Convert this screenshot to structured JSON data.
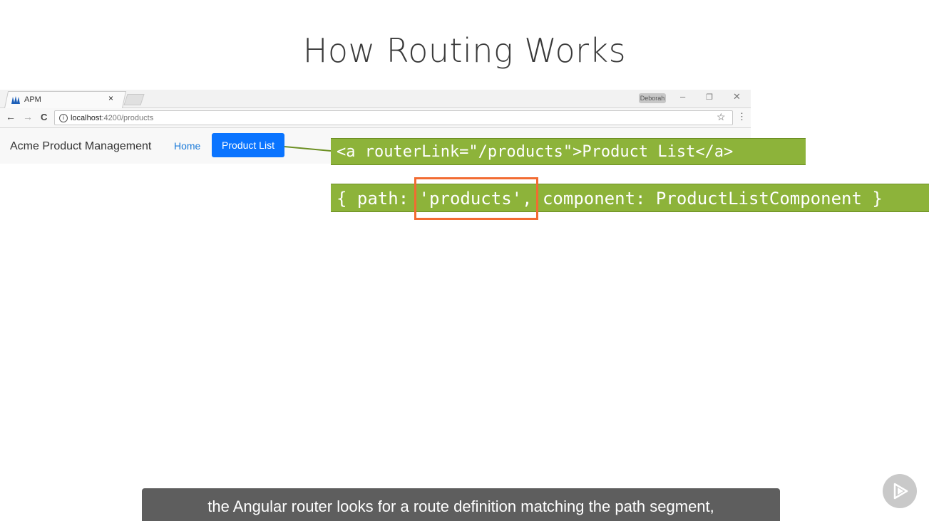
{
  "slide": {
    "title": "How Routing Works"
  },
  "browser": {
    "tab": {
      "title": "APM",
      "close": "×"
    },
    "window": {
      "user": "Deborah",
      "minimize": "–",
      "restore": "❐",
      "close": "✕"
    },
    "toolbar": {
      "back": "←",
      "forward": "→",
      "reload": "C",
      "info": "i",
      "url_host": "localhost",
      "url_path": ":4200/products",
      "star": "☆",
      "menu": "⋮"
    }
  },
  "app": {
    "brand": "Acme Product Management",
    "nav": {
      "home": "Home",
      "product_list": "Product List"
    }
  },
  "callouts": {
    "router_link": "<a routerLink=\"/products\">Product List</a>",
    "route_definition": "{ path: 'products', component: ProductListComponent }"
  },
  "caption": {
    "text": "the Angular router looks for a route definition matching the path segment,"
  },
  "colors": {
    "code_background": "#8db33a",
    "highlight_border": "#f26b32",
    "active_nav": "#0a74ff",
    "caption_background": "#5e5e5e"
  },
  "icons": {
    "tab_favicon": "angular-shield-icon",
    "play_badge": "play-icon"
  }
}
